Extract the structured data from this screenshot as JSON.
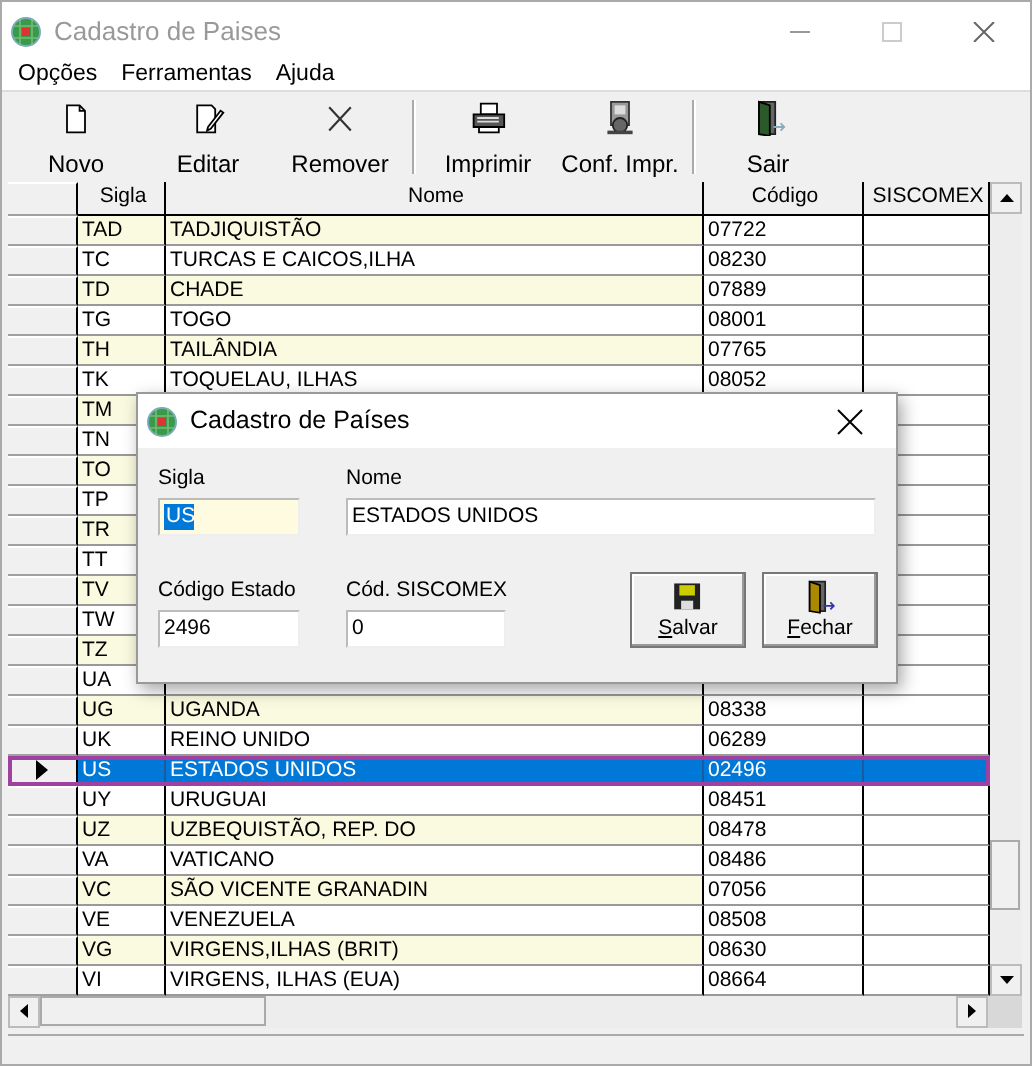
{
  "window": {
    "title": "Cadastro de Paises",
    "active": false
  },
  "menu": [
    {
      "label": "Opções"
    },
    {
      "label": "Ferramentas"
    },
    {
      "label": "Ajuda"
    }
  ],
  "toolbar": [
    {
      "label": "Novo",
      "kind": "new",
      "separator_after": false
    },
    {
      "label": "Editar",
      "kind": "edit",
      "separator_after": false
    },
    {
      "label": "Remover",
      "kind": "remove",
      "separator_after": true
    },
    {
      "label": "Imprimir",
      "kind": "print",
      "separator_after": false
    },
    {
      "label": "Conf. Impr.",
      "kind": "printsetup",
      "separator_after": true
    },
    {
      "label": "Sair",
      "kind": "exit",
      "separator_after": false
    }
  ],
  "grid": {
    "columns": [
      "Sigla",
      "Nome",
      "Código",
      "SISCOMEX"
    ],
    "rows": [
      {
        "sigla": "TAD",
        "nome": "TADJIQUISTÃO",
        "codigo": "07722",
        "selected": false
      },
      {
        "sigla": "TC",
        "nome": "TURCAS E CAICOS,ILHA",
        "codigo": "08230",
        "selected": false
      },
      {
        "sigla": "TD",
        "nome": "CHADE",
        "codigo": "07889",
        "selected": false
      },
      {
        "sigla": "TG",
        "nome": "TOGO",
        "codigo": "08001",
        "selected": false
      },
      {
        "sigla": "TH",
        "nome": "TAILÂNDIA",
        "codigo": "07765",
        "selected": false
      },
      {
        "sigla": "TK",
        "nome": "TOQUELAU, ILHAS",
        "codigo": "08052",
        "selected": false
      },
      {
        "sigla": "TM",
        "selected": false
      },
      {
        "sigla": "TN",
        "selected": false
      },
      {
        "sigla": "TO",
        "selected": false
      },
      {
        "sigla": "TP",
        "selected": false
      },
      {
        "sigla": "TR",
        "selected": false
      },
      {
        "sigla": "TT",
        "selected": false
      },
      {
        "sigla": "TV",
        "selected": false
      },
      {
        "sigla": "TW",
        "selected": false
      },
      {
        "sigla": "TZ",
        "selected": false
      },
      {
        "sigla": "UA",
        "selected": false
      },
      {
        "sigla": "UG",
        "nome": "UGANDA",
        "codigo": "08338",
        "selected": false
      },
      {
        "sigla": "UK",
        "nome": "REINO UNIDO",
        "codigo": "06289",
        "selected": false
      },
      {
        "sigla": "US",
        "nome": "ESTADOS UNIDOS",
        "codigo": "02496",
        "selected": true
      },
      {
        "sigla": "UY",
        "nome": "URUGUAI",
        "codigo": "08451",
        "selected": false
      },
      {
        "sigla": "UZ",
        "nome": "UZBEQUISTÃO, REP. DO",
        "codigo": "08478",
        "selected": false
      },
      {
        "sigla": "VA",
        "nome": "VATICANO",
        "codigo": "08486",
        "selected": false
      },
      {
        "sigla": "VC",
        "nome": "SÃO VICENTE GRANADIN",
        "codigo": "07056",
        "selected": false
      },
      {
        "sigla": "VE",
        "nome": "VENEZUELA",
        "codigo": "08508",
        "selected": false
      },
      {
        "sigla": "VG",
        "nome": "VIRGENS,ILHAS (BRIT)",
        "codigo": "08630",
        "selected": false
      },
      {
        "sigla": "VI",
        "nome": "VIRGENS, ILHAS (EUA)",
        "codigo": "08664",
        "selected": false
      }
    ]
  },
  "dialog": {
    "title": "Cadastro de Países",
    "fields": [
      {
        "label": "Sigla",
        "value": "US",
        "focused": true
      },
      {
        "label": "Nome",
        "value": "ESTADOS UNIDOS",
        "focused": false
      },
      {
        "label": "Código Estado",
        "value": "2496",
        "focused": false
      },
      {
        "label": "Cód. SISCOMEX",
        "value": "0",
        "focused": false
      }
    ],
    "buttons": [
      {
        "label": "Salvar",
        "kind": "save"
      },
      {
        "label": "Fechar",
        "kind": "close"
      }
    ]
  }
}
